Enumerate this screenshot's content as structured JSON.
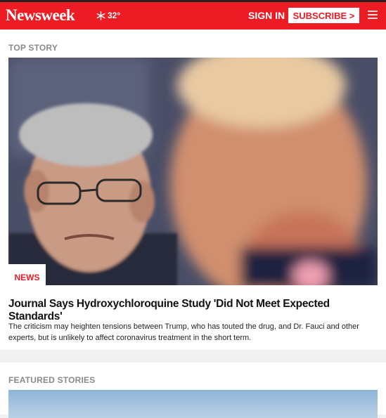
{
  "header": {
    "logo": "Newsweek",
    "weather": {
      "icon": "snowflake-icon",
      "temperature": "32°"
    },
    "signin_label": "SIGN IN",
    "subscribe_label": "SUBSCRIBE >",
    "menu_icon": "hamburger-menu-icon",
    "colors": {
      "brand": "#ed1b24"
    }
  },
  "top_story": {
    "section_label": "TOP STORY",
    "category": "NEWS",
    "headline": "Journal Says Hydroxychloroquine Study 'Did Not Meet Expected Standards'",
    "summary": "The criticism may heighten tensions between Trump, who has touted the drug, and Dr. Fauci and other experts, but is unlikely to affect coronavirus treatment in the short term."
  },
  "featured": {
    "section_label": "FEATURED STORIES"
  }
}
